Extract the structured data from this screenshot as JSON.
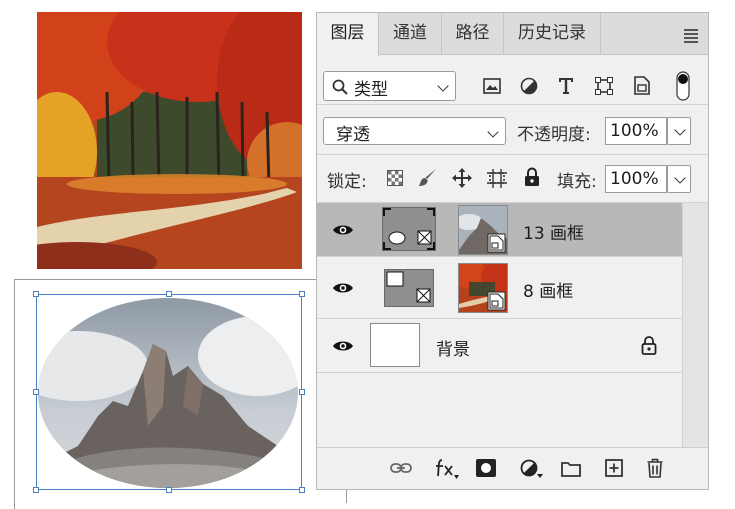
{
  "tabs": [
    {
      "label": "图层",
      "active": true
    },
    {
      "label": "通道",
      "active": false
    },
    {
      "label": "路径",
      "active": false
    },
    {
      "label": "历史记录",
      "active": false
    }
  ],
  "filter": {
    "label": "类型",
    "icons": [
      "image-filter-icon",
      "adjustment-filter-icon",
      "type-filter-icon",
      "shape-filter-icon",
      "smart-object-filter-icon",
      "filter-toggle-icon"
    ]
  },
  "blend": {
    "mode": "穿透",
    "opacity_label": "不透明度:",
    "opacity_value": "100%"
  },
  "lock": {
    "label": "锁定:",
    "fill_label": "填充:",
    "fill_value": "100%",
    "icons": [
      "lock-transparency-icon",
      "lock-image-icon",
      "lock-position-icon",
      "lock-artboard-icon",
      "lock-all-icon"
    ]
  },
  "layers": [
    {
      "name": "13 画框",
      "selected": true,
      "visible": true,
      "frame_shape": "ellipse",
      "thumb": "mountain"
    },
    {
      "name": "8 画框",
      "selected": false,
      "visible": true,
      "frame_shape": "rectangle",
      "thumb": "forest"
    },
    {
      "name": "背景",
      "selected": false,
      "visible": true,
      "locked": true,
      "thumb": "blank"
    }
  ],
  "bottom_icons": [
    "link-layers-icon",
    "layer-effects-icon",
    "add-mask-icon",
    "adjustment-layer-icon",
    "new-group-icon",
    "new-layer-icon",
    "delete-layer-icon"
  ],
  "colors": {
    "accent": "#4a7fc4",
    "selected_row": "#b8b8b8",
    "panel_bg": "#f0f0f0"
  }
}
